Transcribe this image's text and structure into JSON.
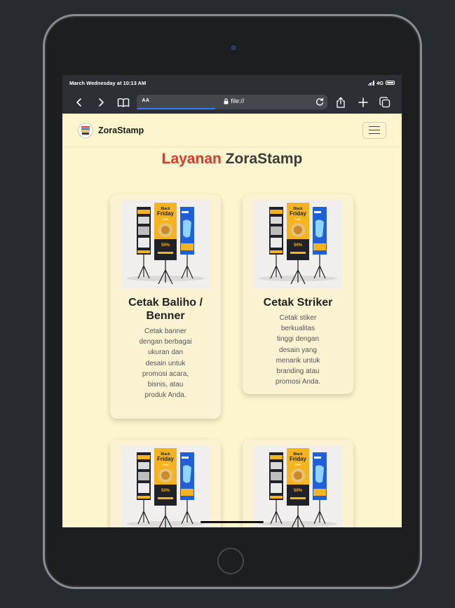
{
  "status": {
    "time": "March Wednesday at 10:13 AM",
    "network": "4G"
  },
  "browser": {
    "text_size_label": "AA",
    "url": "file://"
  },
  "site": {
    "brand": "ZoraStamp",
    "title_accent": "Layanan",
    "title_rest": "ZoraStamp"
  },
  "cards": [
    {
      "title": "Cetak Baliho / Benner",
      "title_l1": "Cetak Baliho /",
      "title_l2": "Benner",
      "description": "Cetak banner dengan berbagai ukuran dan desain untuk promosi acara, bisnis, atau produk Anda."
    },
    {
      "title": "Cetak Striker",
      "description": "Cetak stiker berkualitas tinggi dengan desain yang menarik untuk branding atau promosi Anda."
    },
    {
      "title": "",
      "description": ""
    },
    {
      "title": "",
      "description": ""
    }
  ],
  "banner_text": {
    "t1": "Black Friday",
    "sale": "Sale",
    "discount": "50%"
  },
  "colors": {
    "accent": "#d53a2a",
    "page_bg": "#fcf5cd",
    "card_bg": "#fbf2d2",
    "banner_yellow": "#f5b41d",
    "banner_blue": "#1f5fd8"
  },
  "icons": [
    "back-icon",
    "forward-icon",
    "bookmarks-icon",
    "lock-icon",
    "reload-icon",
    "share-icon",
    "new-tab-icon",
    "tabs-icon",
    "hamburger-icon"
  ]
}
